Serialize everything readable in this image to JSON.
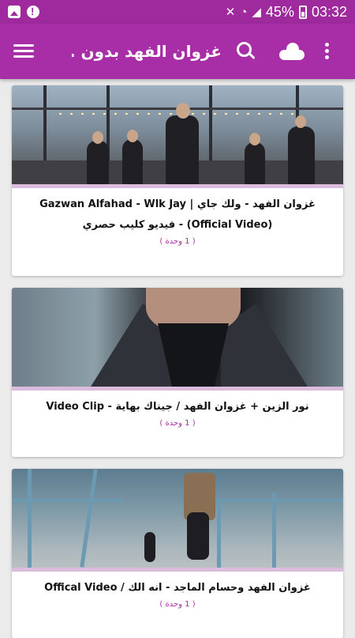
{
  "status_bar": {
    "battery_percent": "45%",
    "time": "03:32",
    "icons": [
      "image-icon",
      "message-icon",
      "mute-icon",
      "wifi-icon",
      "signal-icon",
      "battery-icon"
    ]
  },
  "app_bar": {
    "title": "غزوان الفهد بدون ...",
    "icons": [
      "menu-icon",
      "search-icon",
      "cloud-icon",
      "more-icon"
    ]
  },
  "colors": {
    "primary": "#a82ea8",
    "status_bar": "#9e2a9e",
    "divider": "#dcbcdc",
    "background": "#ebebeb"
  },
  "videos": [
    {
      "title": "غزوان الفهد - ولك جاي | Gazwan Alfahad - Wlk Jay (Official Video) - فيديو كليب حصري",
      "count": "( 1 وحدة )"
    },
    {
      "title": "نور الزين + غزوان الفهد / جيناك بهاية - Video Clip",
      "count": "( 1 وحدة )"
    },
    {
      "title": "غزوان الفهد وحسام الماجد - انه الك / Offical Video",
      "count": "( 1 وحدة )"
    }
  ]
}
